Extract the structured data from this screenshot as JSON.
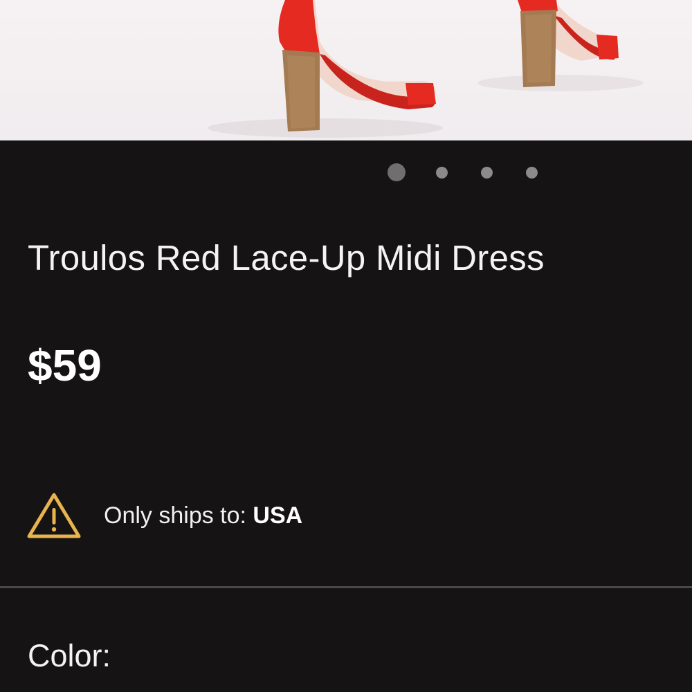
{
  "hero_image": {
    "alt": "product-photo",
    "accent_color": "#e52a22",
    "heel_color": "#a47a52"
  },
  "carousel": {
    "dot_count": 4,
    "active_index": 0
  },
  "product": {
    "title": "Troulos Red Lace-Up Midi Dress",
    "price": "$59"
  },
  "shipping": {
    "icon": "warning-triangle-icon",
    "label": "Only ships to: ",
    "value": "USA",
    "icon_color": "#e8b44c"
  },
  "options": {
    "color_label": "Color:"
  }
}
